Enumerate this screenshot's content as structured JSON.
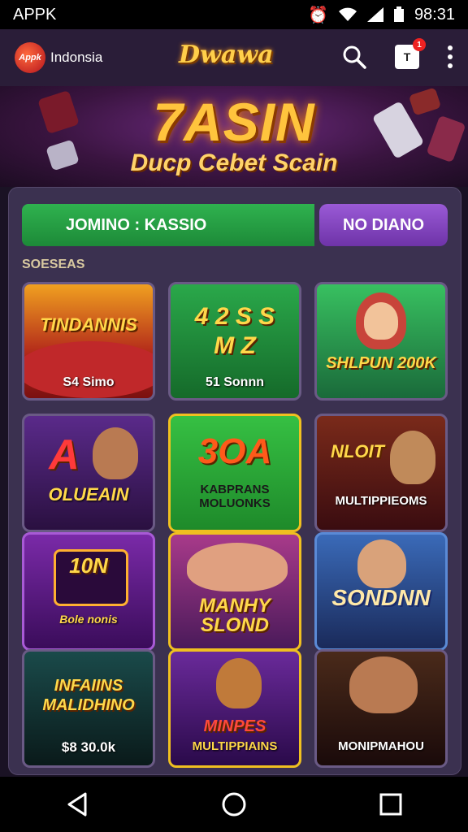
{
  "status_bar": {
    "carrier": "APPK",
    "time": "98:31"
  },
  "app_bar": {
    "logo_text": "Appk",
    "region": "Indonsia",
    "brand": "Dwawa",
    "notification_badge": "T",
    "notification_count": "1"
  },
  "banner": {
    "title": "7ASIN",
    "subtitle": "Ducp Cebet Scain"
  },
  "tabs": {
    "primary_label": "JOMINO : KASSIO",
    "secondary_label": "NO DIANO"
  },
  "section_label": "SOESEAS",
  "games": [
    {
      "title": "TINDANNIS",
      "caption": "S4 Simo"
    },
    {
      "title": "4 2 S S M Z",
      "caption": "51 Sonnn"
    },
    {
      "title": "SHLPUN 200K",
      "caption": ""
    },
    {
      "title": "A",
      "caption": "OLUEAIN"
    },
    {
      "title": "3OA",
      "caption": "KABPRANS MOLUONKS"
    },
    {
      "title": "NLOIT",
      "caption": "MULTIPPIEOMS"
    },
    {
      "title": "10N",
      "caption": "Bole nonis"
    },
    {
      "title": "MANHY SLOND",
      "caption": ""
    },
    {
      "title": "SONDNN",
      "caption": ""
    },
    {
      "title": "INFAIINS MALIDHINO",
      "caption": "$8 30.0k"
    },
    {
      "title": "MINPES",
      "caption": "MULTIPPIAINS"
    },
    {
      "title": "",
      "caption": "MONIPMAHOU"
    }
  ],
  "colors": {
    "accent_green": "#2fb24f",
    "accent_purple": "#8a47c8",
    "gold": "#ffc43d"
  }
}
